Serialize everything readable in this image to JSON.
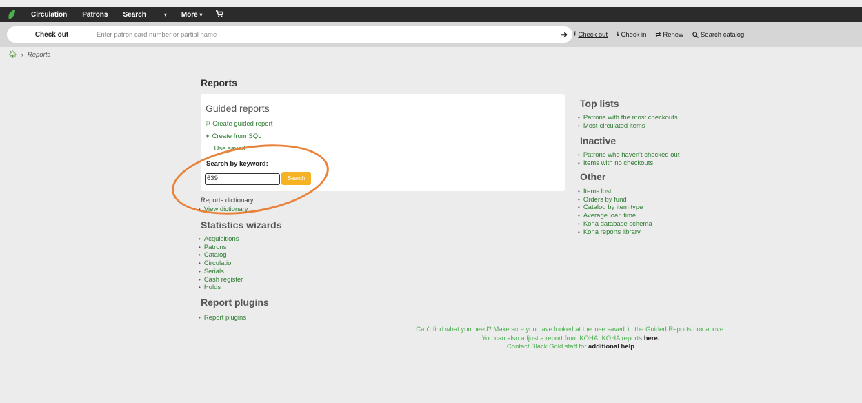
{
  "nav": {
    "items": [
      "Circulation",
      "Patrons",
      "Search"
    ],
    "more": "More",
    "caret": "▾"
  },
  "checkbar": {
    "label": "Check out",
    "placeholder": "Enter patron card number or partial name",
    "links": [
      {
        "icon": "upload-icon",
        "label": "Check out"
      },
      {
        "icon": "download-icon",
        "label": "Check in"
      },
      {
        "icon": "renew-icon",
        "label": "Renew"
      },
      {
        "icon": "search-icon",
        "label": "Search catalog"
      }
    ]
  },
  "breadcrumb": {
    "current": "Reports"
  },
  "page_title": "Reports",
  "guided": {
    "title": "Guided reports",
    "links": [
      {
        "icon": "wizard-icon",
        "label": "Create guided report"
      },
      {
        "icon": "plus-icon",
        "label": "Create from SQL"
      },
      {
        "icon": "list-icon",
        "label": "Use saved"
      }
    ],
    "keyword_label": "Search by keyword:",
    "keyword_value": "639",
    "search_button": "Search"
  },
  "dictionary": {
    "title": "Reports dictionary",
    "link": "View dictionary"
  },
  "statistics": {
    "title": "Statistics wizards",
    "items": [
      "Acquisitions",
      "Patrons",
      "Catalog",
      "Circulation",
      "Serials",
      "Cash register",
      "Holds"
    ]
  },
  "plugins": {
    "title": "Report plugins",
    "items": [
      "Report plugins"
    ]
  },
  "top_lists": {
    "title": "Top lists",
    "items": [
      "Patrons with the most checkouts",
      "Most-circulated items"
    ]
  },
  "inactive": {
    "title": "Inactive",
    "items": [
      "Patrons who haven't checked out",
      "Items with no checkouts"
    ]
  },
  "other": {
    "title": "Other",
    "items": [
      "Items lost",
      "Orders by fund",
      "Catalog by item type",
      "Average loan time",
      "Koha database schema",
      "Koha reports library"
    ]
  },
  "notes": {
    "line1": "Can't find what you need?  Make sure you  have looked at the 'use saved' in the Guided Reports box above.",
    "line2": "You can also adjust a report from KOHA!  KOHA reports ",
    "line2_link": "here.",
    "line3": "Contact Black Gold staff for ",
    "line3_link": "additional help"
  },
  "colors": {
    "topbar": "#2b2b2b",
    "accent_green": "#2e7d32",
    "search_button": "#f5b324",
    "annotation": "#e9823a"
  }
}
